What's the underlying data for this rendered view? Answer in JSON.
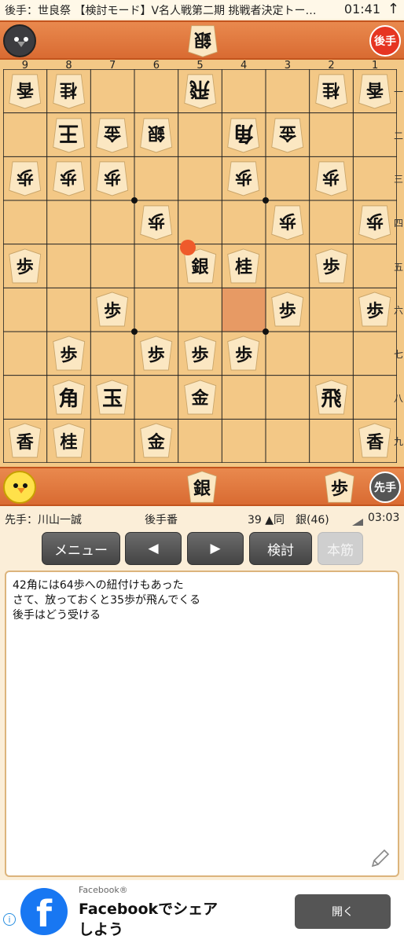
{
  "status_bar": {
    "title": "後手：世良祭 【検討モード】V名人戦第二期 挑戦者決定トー…",
    "time": "01:41",
    "up_icon": "↑"
  },
  "gote_hand": {
    "badge": "後手",
    "pieces": [
      {
        "char": "銀"
      }
    ]
  },
  "sente_hand": {
    "badge": "先手",
    "pieces": [
      {
        "char": "銀"
      },
      {
        "char": "歩"
      }
    ]
  },
  "board": {
    "file_labels": [
      "9",
      "8",
      "7",
      "6",
      "5",
      "4",
      "3",
      "2",
      "1"
    ],
    "rank_labels": [
      "一",
      "二",
      "三",
      "四",
      "五",
      "六",
      "七",
      "八",
      "九"
    ],
    "highlight": {
      "file": 4,
      "rank": 6
    },
    "last_move_marker": {
      "file": 5,
      "rank": 5
    },
    "pieces": [
      {
        "char": "香",
        "owner": "gote",
        "file": 9,
        "rank": 1
      },
      {
        "char": "桂",
        "owner": "gote",
        "file": 8,
        "rank": 1
      },
      {
        "char": "飛",
        "owner": "gote",
        "file": 5,
        "rank": 1
      },
      {
        "char": "桂",
        "owner": "gote",
        "file": 2,
        "rank": 1
      },
      {
        "char": "香",
        "owner": "gote",
        "file": 1,
        "rank": 1
      },
      {
        "char": "王",
        "owner": "gote",
        "file": 8,
        "rank": 2
      },
      {
        "char": "金",
        "owner": "gote",
        "file": 7,
        "rank": 2
      },
      {
        "char": "銀",
        "owner": "gote",
        "file": 6,
        "rank": 2
      },
      {
        "char": "角",
        "owner": "gote",
        "file": 4,
        "rank": 2
      },
      {
        "char": "金",
        "owner": "gote",
        "file": 3,
        "rank": 2
      },
      {
        "char": "歩",
        "owner": "gote",
        "file": 9,
        "rank": 3
      },
      {
        "char": "歩",
        "owner": "gote",
        "file": 8,
        "rank": 3
      },
      {
        "char": "歩",
        "owner": "gote",
        "file": 7,
        "rank": 3
      },
      {
        "char": "歩",
        "owner": "gote",
        "file": 4,
        "rank": 3
      },
      {
        "char": "歩",
        "owner": "gote",
        "file": 2,
        "rank": 3
      },
      {
        "char": "歩",
        "owner": "gote",
        "file": 6,
        "rank": 4
      },
      {
        "char": "歩",
        "owner": "gote",
        "file": 3,
        "rank": 4
      },
      {
        "char": "歩",
        "owner": "gote",
        "file": 1,
        "rank": 4
      },
      {
        "char": "歩",
        "owner": "sente",
        "file": 9,
        "rank": 5
      },
      {
        "char": "銀",
        "owner": "sente",
        "file": 5,
        "rank": 5
      },
      {
        "char": "桂",
        "owner": "sente",
        "file": 4,
        "rank": 5
      },
      {
        "char": "歩",
        "owner": "sente",
        "file": 2,
        "rank": 5
      },
      {
        "char": "歩",
        "owner": "sente",
        "file": 7,
        "rank": 6
      },
      {
        "char": "歩",
        "owner": "sente",
        "file": 3,
        "rank": 6
      },
      {
        "char": "歩",
        "owner": "sente",
        "file": 1,
        "rank": 6
      },
      {
        "char": "歩",
        "owner": "sente",
        "file": 8,
        "rank": 7
      },
      {
        "char": "歩",
        "owner": "sente",
        "file": 6,
        "rank": 7
      },
      {
        "char": "歩",
        "owner": "sente",
        "file": 5,
        "rank": 7
      },
      {
        "char": "歩",
        "owner": "sente",
        "file": 4,
        "rank": 7
      },
      {
        "char": "角",
        "owner": "sente",
        "file": 8,
        "rank": 8
      },
      {
        "char": "玉",
        "owner": "sente",
        "file": 7,
        "rank": 8
      },
      {
        "char": "金",
        "owner": "sente",
        "file": 5,
        "rank": 8
      },
      {
        "char": "飛",
        "owner": "sente",
        "file": 2,
        "rank": 8
      },
      {
        "char": "香",
        "owner": "sente",
        "file": 9,
        "rank": 9
      },
      {
        "char": "桂",
        "owner": "sente",
        "file": 8,
        "rank": 9
      },
      {
        "char": "金",
        "owner": "sente",
        "file": 6,
        "rank": 9
      },
      {
        "char": "香",
        "owner": "sente",
        "file": 1,
        "rank": 9
      }
    ]
  },
  "info": {
    "sente_player": "先手：川山一誠",
    "turn": "後手番",
    "move": "39 ▲同　銀(46)",
    "clock": "03:03"
  },
  "buttons": {
    "menu": "メニュー",
    "prev": "◀",
    "next": "▶",
    "kento": "検討",
    "honsuji": "本筋"
  },
  "comment": {
    "lines": [
      "42角には64歩への紐付けもあった",
      "さて、放っておくと35歩が飛んでくる",
      "後手はどう受ける"
    ]
  },
  "ad": {
    "source": "Facebook®",
    "headline1": "Facebookでシェア",
    "headline2": "しよう",
    "button": "開く",
    "info_icon": "i",
    "logo_letter": "f"
  }
}
